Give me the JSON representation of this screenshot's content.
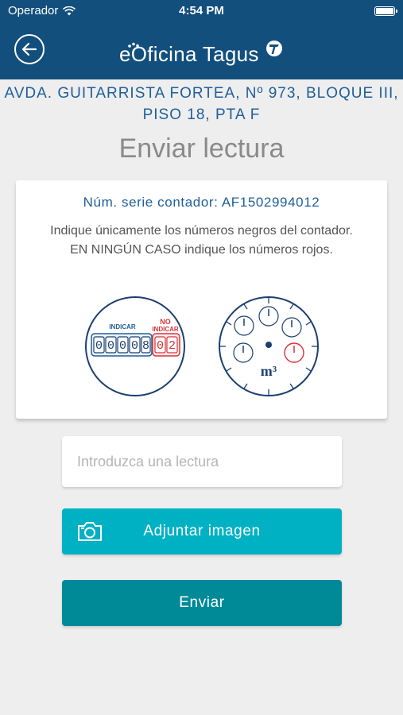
{
  "status_bar": {
    "carrier": "Operador",
    "time": "4:54 PM"
  },
  "header": {
    "brand": "eOficina Tagus"
  },
  "address": {
    "line1": "AVDA. GUITARRISTA FORTEA, Nº 973, BLOQUE III,",
    "line2": "PISO 18, PTA F"
  },
  "page_title": "Enviar lectura",
  "card": {
    "serial": "Núm. serie contador: AF1502994012",
    "instruction": "Indique únicamente los números negros del contador. EN NINGÚN CASO indique los números rojos.",
    "meter1": {
      "label_indicar": "INDICAR",
      "label_no": "NO",
      "label_no_indicar": "INDICAR",
      "black_digits": [
        "0",
        "0",
        "0",
        "0",
        "8"
      ],
      "red_digits": [
        "0",
        "2"
      ]
    },
    "meter2": {
      "unit": "m³"
    }
  },
  "reading_input": {
    "placeholder": "Introduzca una lectura",
    "value": ""
  },
  "buttons": {
    "attach": "Adjuntar imagen",
    "send": "Enviar"
  },
  "colors": {
    "header": "#124f7d",
    "accent_blue": "#1e5f9a",
    "attach": "#00b1c4",
    "send": "#008a98",
    "red": "#d7343a"
  }
}
